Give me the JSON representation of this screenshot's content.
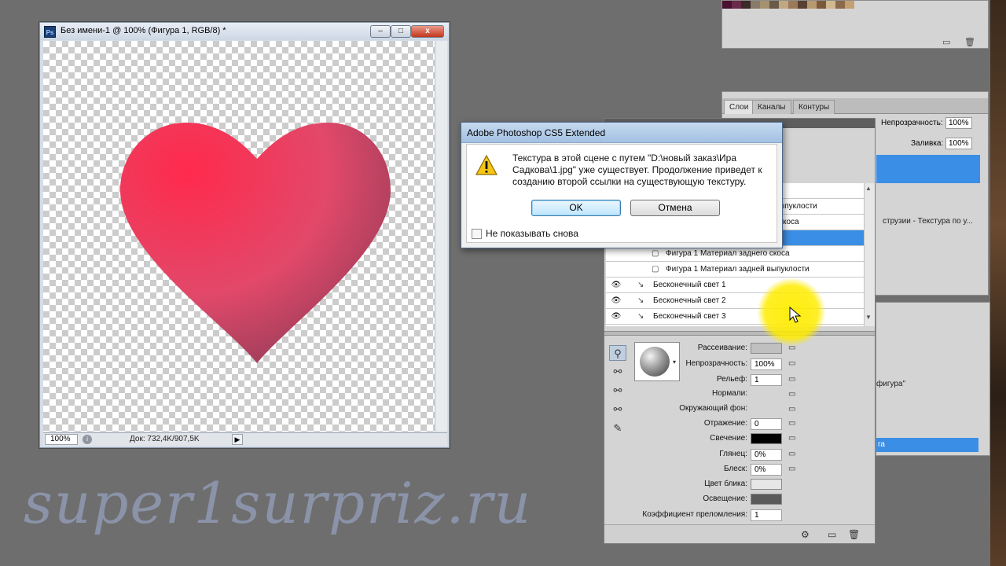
{
  "document": {
    "title": "Без имени-1 @ 100% (Фигура 1, RGB/8) *",
    "app_icon": "Ps",
    "minimize_glyph": "–",
    "maximize_glyph": "□",
    "close_glyph": "x",
    "zoom": "100%",
    "doc_size": "Док: 732,4K/907,5K",
    "status_arrow": "▶",
    "heart_color": "#e63a5e"
  },
  "layers_panel": {
    "tabs": [
      "Слои",
      "Каналы",
      "Контуры"
    ],
    "opacity_label": "Непрозрачность:",
    "opacity_value": "100%",
    "fill_label": "Заливка:",
    "fill_value": "100%",
    "extra_text": "струзии - Текстура по у...",
    "selected_color": "#3b8ee5"
  },
  "props_panel": {
    "line1": "фигура\"",
    "selected_label": "га"
  },
  "panel3d": {
    "tree_rows": [
      {
        "label": "",
        "icon": "",
        "eye": "",
        "selected": false
      },
      {
        "label": "ыпуклости",
        "icon": "",
        "eye": "",
        "selected": false
      },
      {
        "label": "скоса",
        "icon": "",
        "eye": "",
        "selected": false
      },
      {
        "label": "",
        "icon": "",
        "eye": "",
        "selected": true
      },
      {
        "label": "Фигура 1 Материал заднего скоса",
        "icon": "▢",
        "eye": "",
        "selected": false
      },
      {
        "label": "Фигура 1 Материал задней выпуклости",
        "icon": "▢",
        "eye": "",
        "selected": false
      },
      {
        "label": "Бесконечный свет 1",
        "icon": "↘",
        "eye": "👁",
        "selected": false
      },
      {
        "label": "Бесконечный свет 2",
        "icon": "↘",
        "eye": "👁",
        "selected": false
      },
      {
        "label": "Бесконечный свет 3",
        "icon": "↘",
        "eye": "👁",
        "selected": false
      }
    ],
    "scroll_up": "▲",
    "scroll_down": "▼",
    "tools": [
      "⚲",
      "⚯",
      "⚯",
      "⚯",
      "✎"
    ],
    "preview_arrow": "▾",
    "properties": {
      "diffuse_label": "Рассеивание:",
      "opacity_label": "Непрозрачность:",
      "opacity_value": "100%",
      "bump_label": "Рельеф:",
      "bump_value": "1",
      "normal_label": "Нормали:",
      "environment_label": "Окружающий фон:",
      "reflection_label": "Отражение:",
      "reflection_value": "0",
      "illumination_label": "Свечение:",
      "gloss_label": "Глянец:",
      "gloss_value": "0%",
      "shine_label": "Блеск:",
      "shine_value": "0%",
      "specular_label": "Цвет блика:",
      "ambient_label": "Освещение:",
      "refraction_label": "Коэффициент преломления:",
      "refraction_value": "1",
      "diffuse_color": "#c0c0c0",
      "illumination_color": "#000000",
      "specular_color": "#e6e6e6",
      "ambient_color": "#5a5a5a",
      "folder_glyph": "▭"
    },
    "footer_icons": [
      "⚙",
      "▭",
      "🗑"
    ]
  },
  "dialog": {
    "title": "Adobe Photoshop CS5 Extended",
    "message": "Текстура в этой сцене с путем \"D:\\новый заказ\\Ира Садкова\\1.jpg\" уже существует. Продолжение приведет к созданию второй ссылки на существующую текстуру.",
    "ok_label": "OK",
    "cancel_label": "Отмена",
    "checkbox_label": "Не показывать снова"
  },
  "watermark": "super1surpriz.ru"
}
